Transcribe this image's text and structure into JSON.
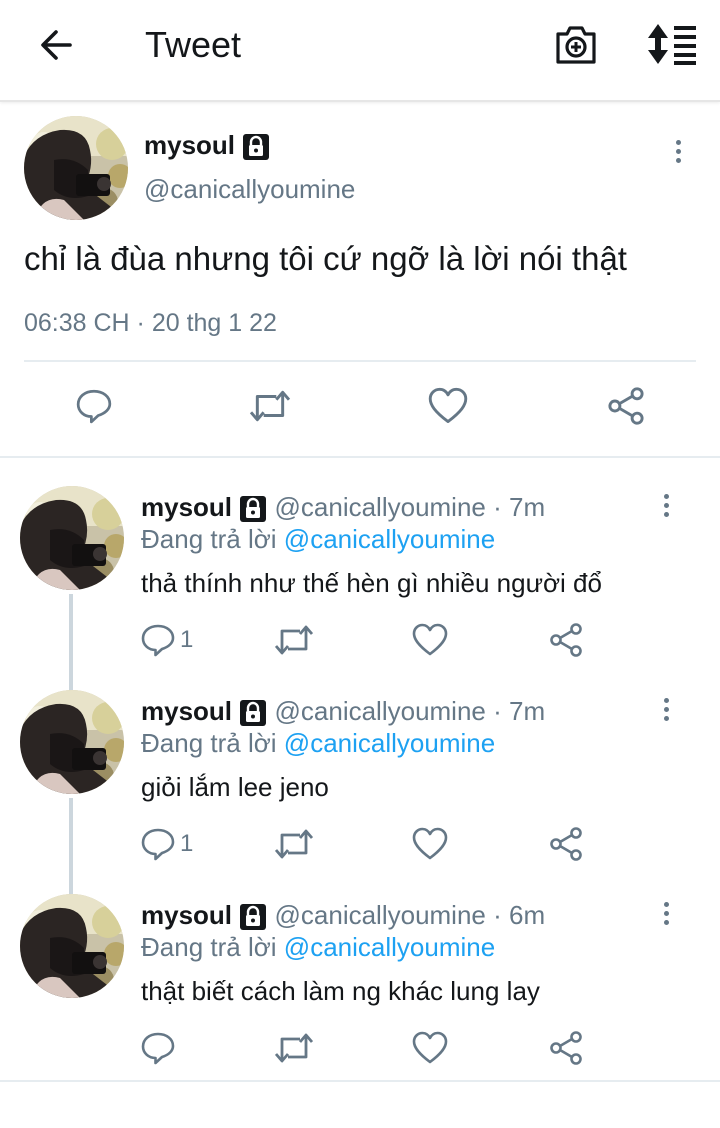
{
  "header": {
    "title": "Tweet",
    "back_icon": "back-arrow-icon",
    "camera_icon": "camera-plus-icon",
    "sort_icon": "sort-icon"
  },
  "main_tweet": {
    "name": "mysoul",
    "handle": "@canicallyoumine",
    "text": "chỉ là đùa nhưng tôi cứ ngỡ là lời nói thật",
    "timestamp": "06:38 CH · 20 thg 1 22"
  },
  "replies": [
    {
      "name": "mysoul",
      "handle_time": "@canicallyoumine · 7m",
      "replying_prefix": "Đang trả lời",
      "replying_to": "@canicallyoumine",
      "text": "thả thính như thế hèn gì nhiều người đổ",
      "reply_count": "1"
    },
    {
      "name": "mysoul",
      "handle_time": "@canicallyoumine · 7m",
      "replying_prefix": "Đang trả lời",
      "replying_to": "@canicallyoumine",
      "text": "giỏi lắm lee jeno",
      "reply_count": "1"
    },
    {
      "name": "mysoul",
      "handle_time": "@canicallyoumine · 6m",
      "replying_prefix": "Đang trả lời",
      "replying_to": "@canicallyoumine",
      "text": "thật biết cách làm ng khác lung lay",
      "reply_count": ""
    }
  ],
  "colors": {
    "text": "#14171a",
    "secondary": "#657786",
    "link": "#1da1f2",
    "divider": "#e6ecf0"
  }
}
